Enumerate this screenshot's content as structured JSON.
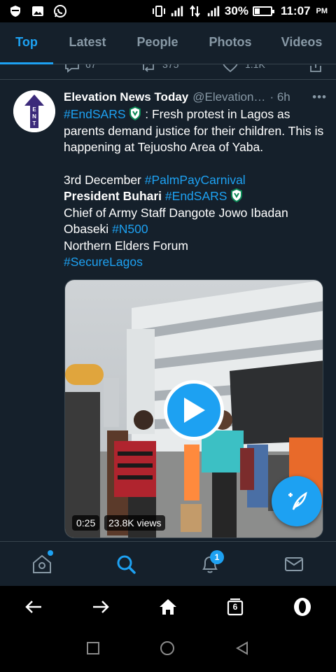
{
  "status_bar": {
    "battery": "30%",
    "time": "11:07",
    "ampm": "PM"
  },
  "tabs": [
    {
      "label": "Top",
      "active": true
    },
    {
      "label": "Latest",
      "active": false
    },
    {
      "label": "People",
      "active": false
    },
    {
      "label": "Photos",
      "active": false
    },
    {
      "label": "Videos",
      "active": false
    }
  ],
  "previous_tweet": {
    "reply_count": "67",
    "retweet_count": "375",
    "like_count": "1.1K"
  },
  "tweet": {
    "name": "Elevation News Today",
    "handle": "@Elevation…",
    "time": "· 6h",
    "more": "•••",
    "line1_tag": "#EndSARS",
    "line1_text": " : Fresh protest in Lagos as parents demand justice for their children. This is happening at Tejuosho Area of Yaba.",
    "date_text": "3rd December ",
    "tag_palmpay": "#PalmPayCarnival",
    "president": "President Buhari",
    "tag_endsars2": " #EndSARS",
    "army_text": "Chief of Army Staff Dangote Jowo Ibadan Obaseki ",
    "tag_n500": "#N500",
    "elders": "Northern Elders Forum",
    "tag_securelagos": "#SecureLagos",
    "media": {
      "duration": "0:25",
      "views": "23.8K views"
    },
    "avatar_letters": "ENT"
  },
  "bottom_nav": {
    "notification_badge": "1"
  },
  "browser": {
    "tab_count": "6"
  },
  "colors": {
    "background": "#15202b",
    "accent": "#1da1f2",
    "secondary_text": "#8899a6",
    "divider": "#38444d"
  }
}
